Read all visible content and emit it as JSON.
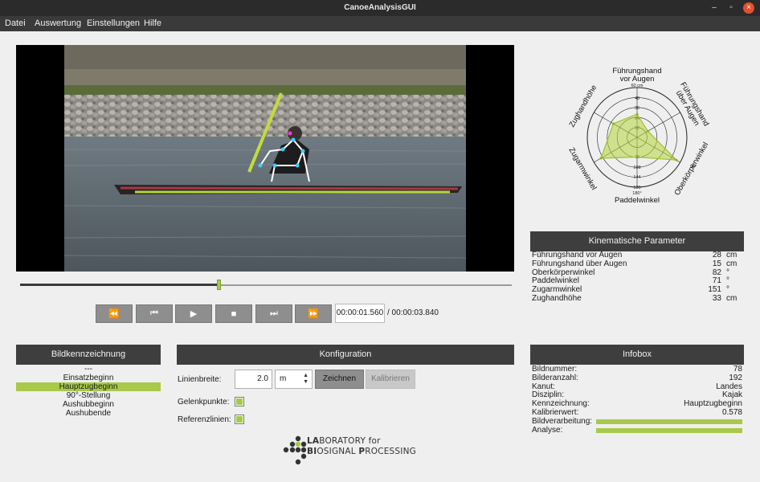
{
  "window": {
    "title": "CanoeAnalysisGUI",
    "controls": {
      "minimize": "–",
      "maximize": "▫",
      "close": "×"
    }
  },
  "menu": [
    "Datei",
    "Auswertung",
    "Einstellungen",
    "Hilfe"
  ],
  "player": {
    "progress": 0.406,
    "current_time": "00:00:01.560",
    "total_time": "/ 00:00:03.840",
    "buttons": [
      "⏪",
      "⏮",
      "▶",
      "■",
      "⏭",
      "⏩"
    ]
  },
  "radar": {
    "axes": [
      "Führungshand vor Augen",
      "Führungshand über Augen",
      "Oberkörperwinkel",
      "Paddelwinkel",
      "Zugarmwinkel",
      "Zughandhöhe"
    ],
    "axis_labels": [
      [
        "Führungshand",
        "vor Augen"
      ],
      [
        "Führungshand",
        "über Augen"
      ],
      [
        "Oberkörperwinkel"
      ],
      [
        "Paddelwinkel"
      ],
      [
        "Zugarmwinkel"
      ],
      [
        "Zughandhöhe"
      ]
    ],
    "ticks": [
      "12",
      "24",
      "36",
      "48",
      "60",
      "72",
      "108",
      "144",
      "180",
      "60 cm",
      "90°",
      "180°"
    ],
    "values": [
      28,
      15,
      82,
      71,
      151,
      33
    ],
    "max": [
      60,
      60,
      90,
      180,
      180,
      60
    ]
  },
  "kinematics": {
    "title": "Kinematische Parameter",
    "rows": [
      {
        "label": "Führungshand vor Augen",
        "value": "28",
        "unit": "cm"
      },
      {
        "label": "Führungshand über Augen",
        "value": "15",
        "unit": "cm"
      },
      {
        "label": "Oberkörperwinkel",
        "value": "82",
        "unit": "°"
      },
      {
        "label": "Paddelwinkel",
        "value": "71",
        "unit": "°"
      },
      {
        "label": "Zugarmwinkel",
        "value": "151",
        "unit": "°"
      },
      {
        "label": "Zughandhöhe",
        "value": "33",
        "unit": "cm"
      }
    ]
  },
  "bildkennzeichnung": {
    "title": "Bildkennzeichnung",
    "items": [
      "---",
      "Einsatzbeginn",
      "Hauptzugbeginn",
      "90°-Stellung",
      "Aushubbeginn",
      "Aushubende"
    ],
    "selected": 2
  },
  "konfiguration": {
    "title": "Konfiguration",
    "linewidth_label": "Linienbreite:",
    "linewidth_value": "2.0",
    "unit": "m",
    "draw_button": "Zeichnen",
    "calibrate_button": "Kalibrieren",
    "joints_label": "Gelenkpunkte:",
    "reflines_label": "Referenzlinien:"
  },
  "infobox": {
    "title": "Infobox",
    "rows": [
      {
        "label": "Bildnummer:",
        "value": "78"
      },
      {
        "label": "Bilderanzahl:",
        "value": "192"
      },
      {
        "label": "Kanut:",
        "value": "Landes"
      },
      {
        "label": "Disziplin:",
        "value": "Kajak"
      },
      {
        "label": "Kennzeichnung:",
        "value": "Hauptzugbeginn"
      },
      {
        "label": "Kalibrierwert:",
        "value": "0.578"
      }
    ],
    "bildverarbeitung_label": "Bildverarbeitung:",
    "bildverarbeitung_progress": 1.0,
    "analyse_label": "Analyse:",
    "analyse_progress": 1.0
  },
  "logo": {
    "line1_a": "LA",
    "line1_b": "BORATORY for",
    "line2_a": "BI",
    "line2_b": "OSIGNAL ",
    "line2_c": "P",
    "line2_d": "ROCESSING"
  },
  "colors": {
    "accent": "#a8c94a",
    "header": "#3e3e3e",
    "titlebar": "#2b2b2b"
  }
}
